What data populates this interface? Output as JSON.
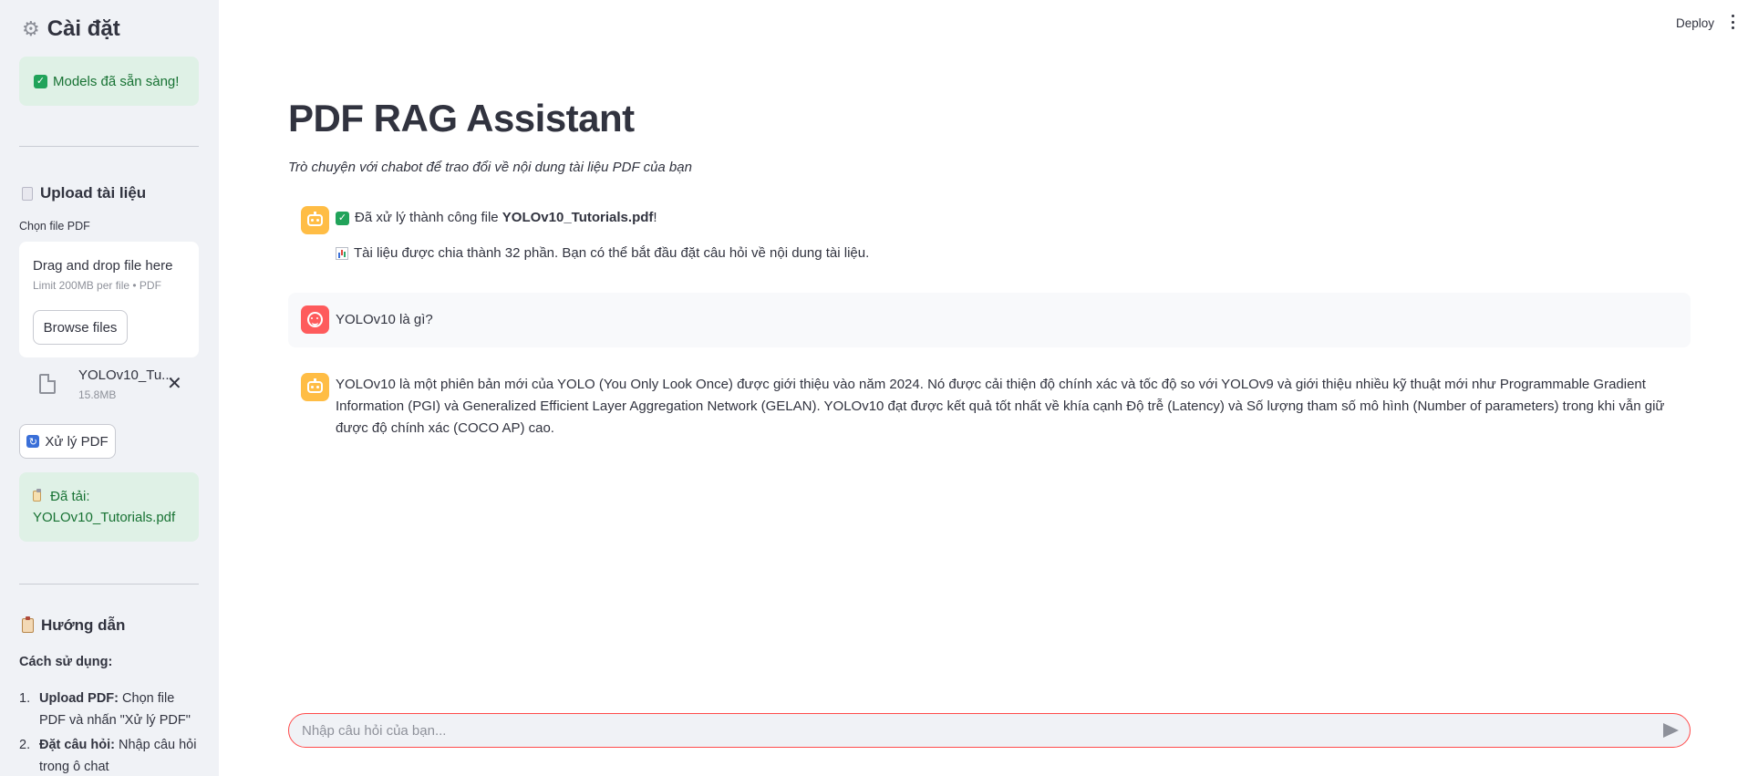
{
  "sidebar": {
    "title": "Cài đặt",
    "models_status": "Models đã sẵn sàng!",
    "upload_heading": "Upload tài liệu",
    "file_label": "Chọn file PDF",
    "dropzone_title": "Drag and drop file here",
    "dropzone_limit": "Limit 200MB per file • PDF",
    "browse_label": "Browse files",
    "file": {
      "name": "YOLOv10_Tu...",
      "size": "15.8MB"
    },
    "process_label": "Xử lý PDF",
    "loaded_prefix": "Đã tải:",
    "loaded_file": "YOLOv10_Tutorials.pdf",
    "help_heading": "Hướng dẫn",
    "help_subtitle": "Cách sử dụng:",
    "help_steps": [
      {
        "num": "1.",
        "bold": "Upload PDF:",
        "text": " Chọn file PDF và nhấn \"Xử lý PDF\""
      },
      {
        "num": "2.",
        "bold": "Đặt câu hỏi:",
        "text": " Nhập câu hỏi trong ô chat"
      }
    ]
  },
  "header": {
    "deploy_label": "Deploy"
  },
  "main": {
    "title": "PDF RAG Assistant",
    "caption": "Trò chuyện với chabot để trao đổi về nội dung tài liệu PDF của bạn",
    "messages": [
      {
        "role": "assistant",
        "success_prefix": "Đã xử lý thành công file ",
        "success_file": "YOLOv10_Tutorials.pdf",
        "success_suffix": "!",
        "info": "Tài liệu được chia thành 32 phần. Bạn có thể bắt đầu đặt câu hỏi về nội dung tài liệu."
      },
      {
        "role": "user",
        "text": "YOLOv10 là gì?"
      },
      {
        "role": "assistant",
        "text": "YOLOv10 là một phiên bản mới của YOLO (You Only Look Once) được giới thiệu vào năm 2024. Nó được cải thiện độ chính xác và tốc độ so với YOLOv9 và giới thiệu nhiều kỹ thuật mới như Programmable Gradient Information (PGI) và Generalized Efficient Layer Aggregation Network (GELAN). YOLOv10 đạt được kết quả tốt nhất về khía cạnh Độ trễ (Latency) và Số lượng tham số mô hình (Number of parameters) trong khi vẫn giữ được độ chính xác (COCO AP) cao."
      }
    ],
    "chat_placeholder": "Nhập câu hỏi của bạn..."
  },
  "icons": {
    "title": "gear-icon",
    "success": "check-icon",
    "upload": "document-icon",
    "file": "file-icon",
    "remove": "close-icon",
    "process": "refresh-icon",
    "loaded": "memo-icon",
    "help": "clipboard-icon",
    "assistant": "robot-avatar-icon",
    "user": "user-avatar-icon",
    "info": "bar-chart-icon",
    "send": "send-icon"
  },
  "colors": {
    "sidebar_bg": "#f0f2f6",
    "success_bg": "#dff1e6",
    "success_text": "#177233",
    "accent": "#ff4b4b",
    "bot_avatar": "#ffbd45"
  }
}
